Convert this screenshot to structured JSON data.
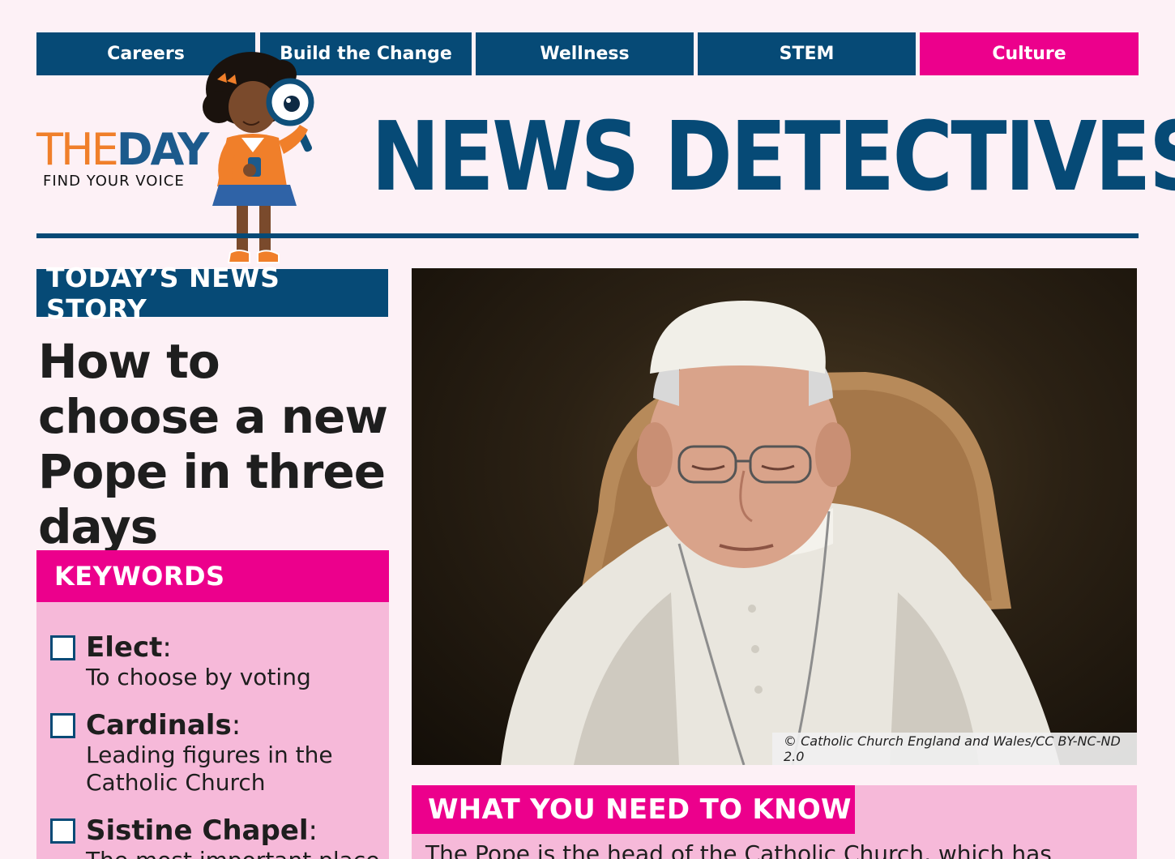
{
  "nav": {
    "tabs": [
      {
        "label": "Careers",
        "active": false
      },
      {
        "label": "Build the Change",
        "active": false
      },
      {
        "label": "Wellness",
        "active": false
      },
      {
        "label": "STEM",
        "active": false
      },
      {
        "label": "Culture",
        "active": true
      }
    ]
  },
  "logo": {
    "the": "THE",
    "day": "DAY",
    "tagline": "FIND YOUR VOICE"
  },
  "masthead": {
    "title": "NEWS DETECTIVES"
  },
  "story": {
    "section_label": "TODAY’S NEWS STORY",
    "headline": "How to choose a new Pope in three days"
  },
  "keywords": {
    "header": "KEYWORDS",
    "items": [
      {
        "term": "Elect",
        "definition": "To choose by voting"
      },
      {
        "term": "Cardinals",
        "definition": "Leading figures in the Catholic Church"
      },
      {
        "term": "Sistine Chapel",
        "definition": "The most important place"
      }
    ]
  },
  "photo": {
    "credit": "© Catholic Church England and Wales/CC BY-NC-ND 2.0"
  },
  "need_to_know": {
    "header": "WHAT YOU NEED TO KNOW",
    "text": "The Pope is the head of the Catholic Church, which has"
  },
  "colors": {
    "navy": "#064a76",
    "magenta": "#ec008c",
    "pink_panel": "#f6b9d9",
    "page_bg": "#fdf1f6",
    "logo_orange": "#f07f2a"
  }
}
